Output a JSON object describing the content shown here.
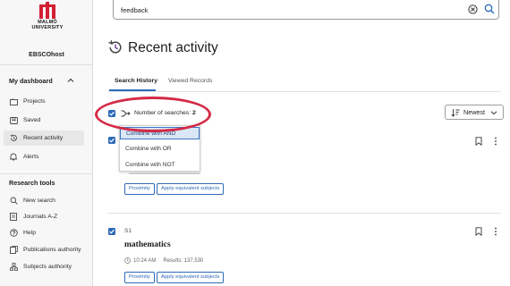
{
  "colors": {
    "accent": "#2d6bb8",
    "logo_red": "#d32032",
    "annotation_red": "#d42a45",
    "selected_bg": "#dbe7f7"
  },
  "sidebar": {
    "logo_line1": "MALMÖ",
    "logo_line2": "UNIVERSITY",
    "app_name": "EBSCOhost",
    "dashboard_heading": "My dashboard",
    "dashboard_items": [
      {
        "label": "Projects",
        "icon": "projects-icon"
      },
      {
        "label": "Saved",
        "icon": "saved-icon"
      },
      {
        "label": "Recent activity",
        "icon": "history-icon",
        "active": true
      },
      {
        "label": "Alerts",
        "icon": "bell-icon"
      }
    ],
    "tools_heading": "Research tools",
    "tools_items": [
      {
        "label": "New search",
        "icon": "search-icon"
      },
      {
        "label": "Journals A-Z",
        "icon": "journal-icon"
      },
      {
        "label": "Help",
        "icon": "help-icon"
      },
      {
        "label": "Publications authority",
        "icon": "publications-icon"
      },
      {
        "label": "Subjects authority",
        "icon": "subjects-icon"
      }
    ]
  },
  "search": {
    "value": "feedback"
  },
  "page": {
    "title": "Recent activity"
  },
  "tabs": [
    {
      "label": "Search History",
      "active": true
    },
    {
      "label": "Viewed Records"
    }
  ],
  "combine": {
    "label": "Number of searches:",
    "count": "2"
  },
  "sort": {
    "label": "Newest"
  },
  "menu": {
    "items": [
      {
        "label": "Combine with AND",
        "selected": true
      },
      {
        "label": "Combine with OR"
      },
      {
        "label": "Combine with NOT"
      }
    ]
  },
  "record1": {
    "chips": [
      "Proximity",
      "Apply equivalent subjects"
    ]
  },
  "record2": {
    "number": "S1",
    "query": "mathematics",
    "time": "10:24 AM",
    "results": "Results: 137,530",
    "chips": [
      "Proximity",
      "Apply equivalent subjects"
    ]
  }
}
